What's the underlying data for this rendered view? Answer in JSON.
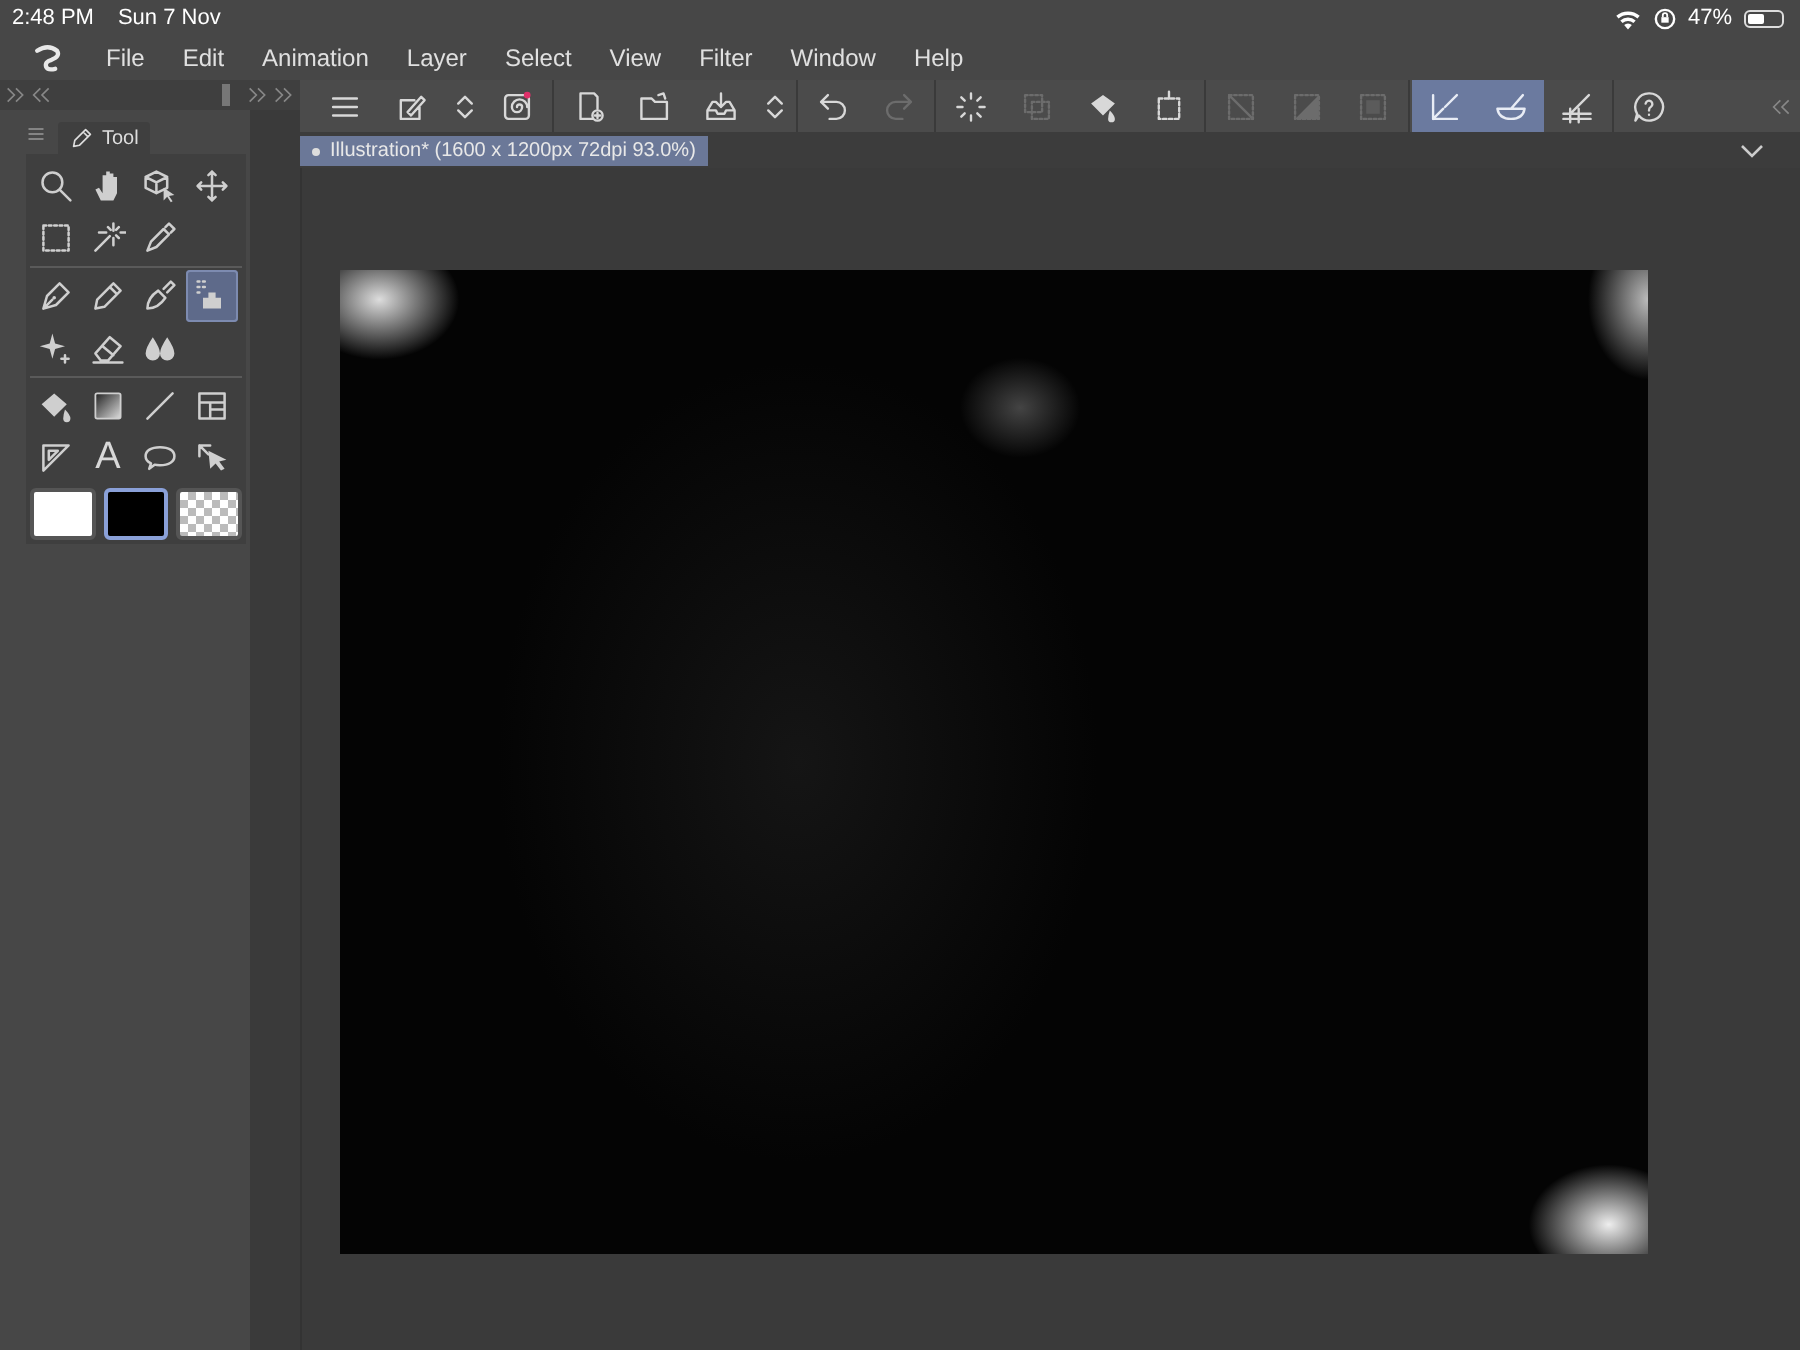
{
  "status_bar": {
    "time": "2:48 PM",
    "date": "Sun 7 Nov",
    "battery": "47%"
  },
  "menu_bar": {
    "items": [
      "File",
      "Edit",
      "Animation",
      "Layer",
      "Select",
      "View",
      "Filter",
      "Window",
      "Help"
    ]
  },
  "command_bar": {
    "buttons": [
      {
        "kind": "menu",
        "selected": false,
        "disabled": false
      },
      {
        "kind": "tool",
        "selected": false,
        "disabled": false
      },
      {
        "kind": "updown",
        "selected": false,
        "disabled": false
      },
      {
        "kind": "spiral",
        "selected": false,
        "disabled": false
      },
      {
        "kind": "sep"
      },
      {
        "kind": "newfile",
        "selected": false,
        "disabled": false
      },
      {
        "kind": "open",
        "selected": false,
        "disabled": false
      },
      {
        "kind": "save",
        "selected": false,
        "disabled": false
      },
      {
        "kind": "updown",
        "selected": false,
        "disabled": false
      },
      {
        "kind": "sep"
      },
      {
        "kind": "undo",
        "selected": false,
        "disabled": false
      },
      {
        "kind": "redo",
        "selected": false,
        "disabled": true
      },
      {
        "kind": "sep"
      },
      {
        "kind": "spinner",
        "selected": false,
        "disabled": false
      },
      {
        "kind": "deselect",
        "selected": false,
        "disabled": true
      },
      {
        "kind": "fill",
        "selected": false,
        "disabled": false
      },
      {
        "kind": "transform",
        "selected": false,
        "disabled": false
      },
      {
        "kind": "sep"
      },
      {
        "kind": "clear",
        "selected": false,
        "disabled": true
      },
      {
        "kind": "half",
        "selected": false,
        "disabled": true
      },
      {
        "kind": "square",
        "selected": false,
        "disabled": true
      },
      {
        "kind": "sep"
      },
      {
        "kind": "ruler",
        "selected": true,
        "disabled": false
      },
      {
        "kind": "bowl",
        "selected": true,
        "disabled": false
      },
      {
        "kind": "grid",
        "selected": false,
        "disabled": false
      },
      {
        "kind": "sep"
      },
      {
        "kind": "help",
        "selected": false,
        "disabled": false
      }
    ]
  },
  "tool_panel": {
    "tab": "Tool",
    "groups": [
      [
        {
          "kind": "zoom",
          "selected": false
        },
        {
          "kind": "hand",
          "selected": false
        },
        {
          "kind": "cube",
          "selected": false
        },
        {
          "kind": "move",
          "selected": false
        },
        {
          "kind": "marquee",
          "selected": false
        },
        {
          "kind": "wand",
          "selected": false
        },
        {
          "kind": "dropper",
          "selected": false
        }
      ],
      [
        {
          "kind": "pen",
          "selected": false
        },
        {
          "kind": "pencil",
          "selected": false
        },
        {
          "kind": "brush",
          "selected": false
        },
        {
          "kind": "airbrush",
          "selected": true
        },
        {
          "kind": "sparkle",
          "selected": false
        },
        {
          "kind": "eraser",
          "selected": false
        },
        {
          "kind": "blend",
          "selected": false
        }
      ],
      [
        {
          "kind": "bucket",
          "selected": false
        },
        {
          "kind": "gradient",
          "selected": false
        },
        {
          "kind": "line",
          "selected": false
        },
        {
          "kind": "frame",
          "selected": false
        },
        {
          "kind": "triangle",
          "selected": false
        },
        {
          "kind": "text",
          "label": "A",
          "selected": false
        },
        {
          "kind": "balloon",
          "selected": false
        },
        {
          "kind": "pointer",
          "selected": false
        }
      ]
    ],
    "swatches": [
      {
        "kind": "solid",
        "color": "#ffffff",
        "selected": false
      },
      {
        "kind": "solid",
        "color": "#000000",
        "selected": true
      },
      {
        "kind": "transparent",
        "selected": false
      }
    ]
  },
  "canvas_tab": {
    "label": "Illustration* (1600 x 1200px 72dpi 93.0%)",
    "selected": true
  }
}
